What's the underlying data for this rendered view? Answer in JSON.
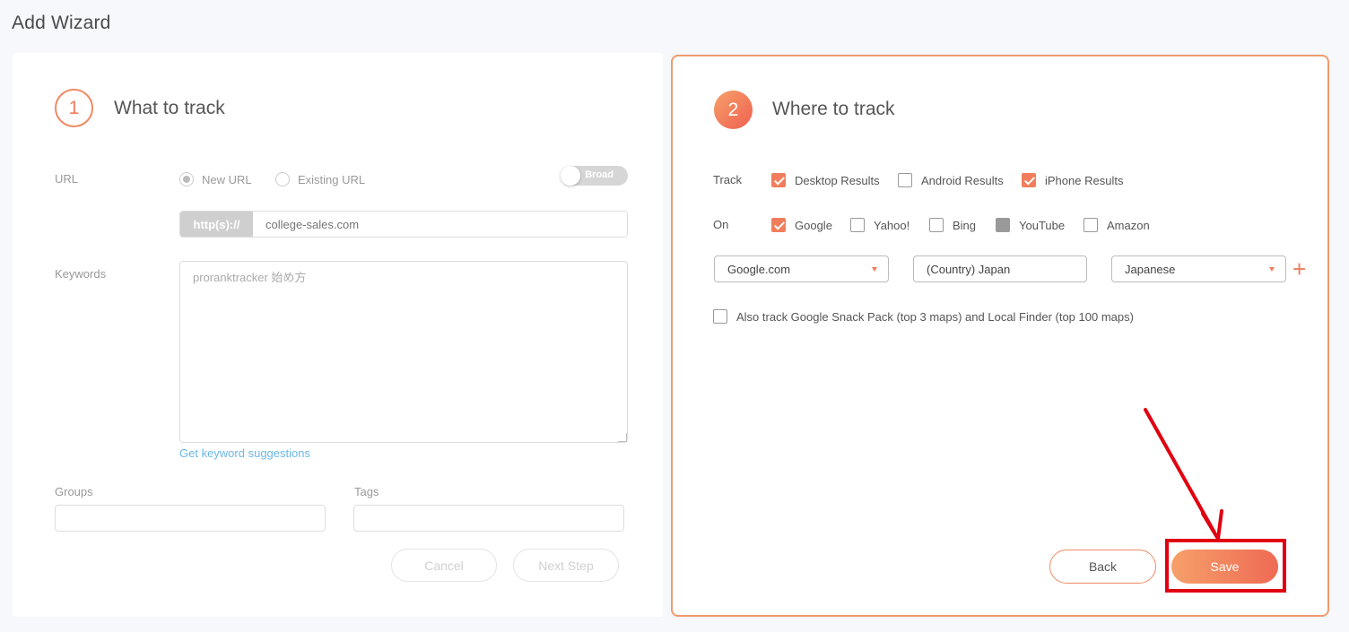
{
  "page": {
    "title": "Add Wizard"
  },
  "step1": {
    "number": "1",
    "title": "What to track",
    "url_label": "URL",
    "radio_new": "New URL",
    "radio_existing": "Existing URL",
    "toggle_label": "Broad",
    "url_prefix": "http(s)://",
    "url_placeholder": "college-sales.com",
    "keywords_label": "Keywords",
    "keywords_value": "proranktracker 始め方",
    "keyword_suggestions": "Get keyword suggestions",
    "groups_label": "Groups",
    "tags_label": "Tags",
    "cancel": "Cancel",
    "next_step": "Next Step"
  },
  "step2": {
    "number": "2",
    "title": "Where to track",
    "track_label": "Track",
    "track_options": [
      {
        "label": "Desktop Results",
        "checked": true
      },
      {
        "label": "Android Results",
        "checked": false
      },
      {
        "label": "iPhone Results",
        "checked": true
      }
    ],
    "on_label": "On",
    "on_options": [
      {
        "label": "Google",
        "checked": true
      },
      {
        "label": "Yahoo!",
        "checked": false
      },
      {
        "label": "Bing",
        "checked": false
      },
      {
        "label": "YouTube",
        "checked": false
      },
      {
        "label": "Amazon",
        "checked": false
      }
    ],
    "engine_select": "Google.com",
    "country_input": "(Country) Japan",
    "language_select": "Japanese",
    "snack_pack": "Also track Google Snack Pack (top 3 maps) and Local Finder (top 100 maps)",
    "back": "Back",
    "save": "Save"
  },
  "colors": {
    "accent": "#f07e5c",
    "annotation": "#e00010"
  }
}
